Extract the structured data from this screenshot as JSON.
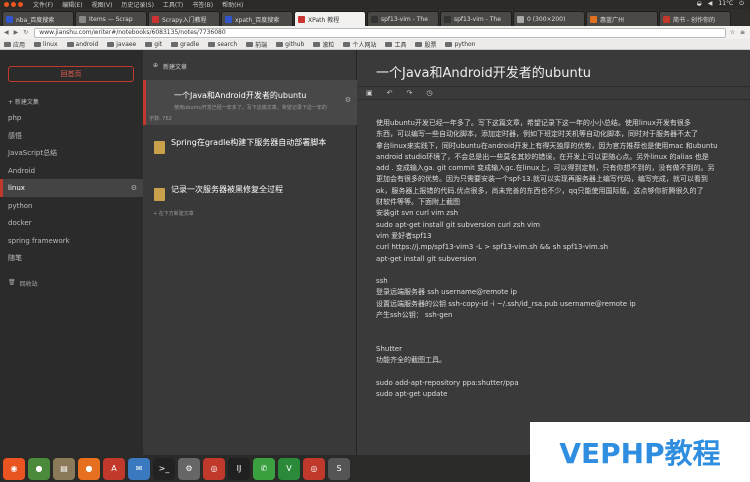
{
  "system_menu": {
    "items": [
      "文件(F)",
      "编辑(E)",
      "视图(V)",
      "历史记录(S)",
      "工具(T)",
      "书签(B)",
      "帮助(H)"
    ],
    "status": "11°C"
  },
  "tabs": [
    {
      "label": "nba_百度搜索",
      "color": "#3355cc"
    },
    {
      "label": "Items — Scrap",
      "color": "#888888"
    },
    {
      "label": "Scrapy入门教程",
      "color": "#cc3333"
    },
    {
      "label": "xpath_百度搜索",
      "color": "#3355cc"
    },
    {
      "label": "XPath 教程",
      "color": "#cc3333",
      "active": true
    },
    {
      "label": "spf13-vim - The",
      "color": "#333333"
    },
    {
      "label": "spf13-vim - The",
      "color": "#333333"
    },
    {
      "label": "0 (300×200)",
      "color": "#aaaaaa"
    },
    {
      "label": "惠蓝广州",
      "color": "#e07020"
    },
    {
      "label": "简书 - 创作你的",
      "color": "#c0392b"
    }
  ],
  "address": {
    "url": "www.jianshu.com/writer#/notebooks/6083135/notes/7736080"
  },
  "bookmarks": [
    "应用",
    "linux",
    "android",
    "javaee",
    "git",
    "gradle",
    "search",
    "前端",
    "github",
    "滚粒",
    "个人网站",
    "工具",
    "股票",
    "python"
  ],
  "sidebar": {
    "home_label": "回首页",
    "new_collection": "+ 新建文集",
    "collections": [
      {
        "label": "php"
      },
      {
        "label": "感悟"
      },
      {
        "label": "JavaScript总结"
      },
      {
        "label": "Android"
      },
      {
        "label": "linux",
        "active": true
      },
      {
        "label": "python"
      },
      {
        "label": "docker"
      },
      {
        "label": "spring framework"
      },
      {
        "label": "随笔"
      }
    ],
    "trash": "回收站"
  },
  "articles": {
    "new_article": "新建文章",
    "items": [
      {
        "title": "一个Java和Android开发者的ubuntu",
        "snippet": "使用ubuntu开发已经一年多了。写下这篇文章，希望记录下这一年的",
        "words": "字数: 762",
        "active": true
      },
      {
        "title": "Spring在gradle构建下服务器自动部署脚本",
        "snippet": "",
        "words": ""
      },
      {
        "title": "记录一次服务器被黑修复全过程",
        "snippet": "",
        "words": ""
      }
    ],
    "bottom_hint": "在下方新建文章"
  },
  "editor": {
    "title": "一个Java和Android开发者的ubuntu",
    "lines": [
      "使用ubuntu开发已经一年多了。写下这篇文章，希望记录下这一年的小小总结。使用linux开发有很多",
      "东西，可以编写一些自动化脚本，添加定时器，例如下班定时关机等自动化脚本，同时对于服务器不太了",
      "拿台linux来实践下，同时ubuntu在android开发上有得天独厚的优势，因为官方推荐也是使用mac 和ubuntu",
      "android studio环境了，不会总是出一些莫名其妙的错误，在开发上可以更随心点。另外linux 的alias 也是",
      "add . 变成输入ga. git commit 变成输入gc.在linux上，可以得到定制，只有你想不到的，没有做不到的。另",
      "更加会有很多的优势。因为只需要安装一个spf-13.就可以实现再服务器上编写代码，编写完成，就可以看到",
      "ok，服务器上报错的代码.优点很多，尚未完善的东西也不少，qq只能使用国际版。这点够你折腾很久的了",
      "财软件等等。下面附上截图",
      "安装git svn curl vim zsh",
      " sudo apt-get install git subversion curl zsh vim",
      "vim 爱好者spf13",
      "curl https://j.mp/spf13-vim3 -L > spf13-vim.sh && sh spf13-vim.sh",
      "apt-get install  git subversion",
      "",
      "ssh",
      "登录远端服务器 ssh username@remote ip",
      "设置远端服务器的公钥 ssh-copy-id -i ~/.ssh/id_rsa.pub username@remote ip",
      "产生ssh公钥： ssh-gen",
      "",
      "",
      "Shutter",
      "功能齐全的截图工具。",
      "",
      "sudo add-apt-repository ppa:shutter/ppa",
      "sudo apt-get update"
    ]
  },
  "watermark": "VEPHP教程",
  "taskbar": [
    {
      "name": "ubuntu-dash-icon",
      "glyph": "◉",
      "color": "#e95420"
    },
    {
      "name": "chrome-icon",
      "glyph": "●",
      "color": "#4a8a3a"
    },
    {
      "name": "files-icon",
      "glyph": "▤",
      "color": "#8a7a5a"
    },
    {
      "name": "firefox-icon",
      "glyph": "●",
      "color": "#e76f20"
    },
    {
      "name": "software-center-icon",
      "glyph": "A",
      "color": "#c0392b"
    },
    {
      "name": "mail-icon",
      "glyph": "✉",
      "color": "#3a78c0"
    },
    {
      "name": "terminal-icon",
      "glyph": ">_",
      "color": "#222222"
    },
    {
      "name": "settings-icon",
      "glyph": "⚙",
      "color": "#666666"
    },
    {
      "name": "netease-music-icon",
      "glyph": "◎",
      "color": "#c0392b"
    },
    {
      "name": "intellij-icon",
      "glyph": "IJ",
      "color": "#202020"
    },
    {
      "name": "wechat-icon",
      "glyph": "✆",
      "color": "#3aa040"
    },
    {
      "name": "vim-icon",
      "glyph": "V",
      "color": "#2a8a3a"
    },
    {
      "name": "music-icon",
      "glyph": "◎",
      "color": "#c0392b"
    },
    {
      "name": "sublime-icon",
      "glyph": "S",
      "color": "#555555"
    }
  ]
}
